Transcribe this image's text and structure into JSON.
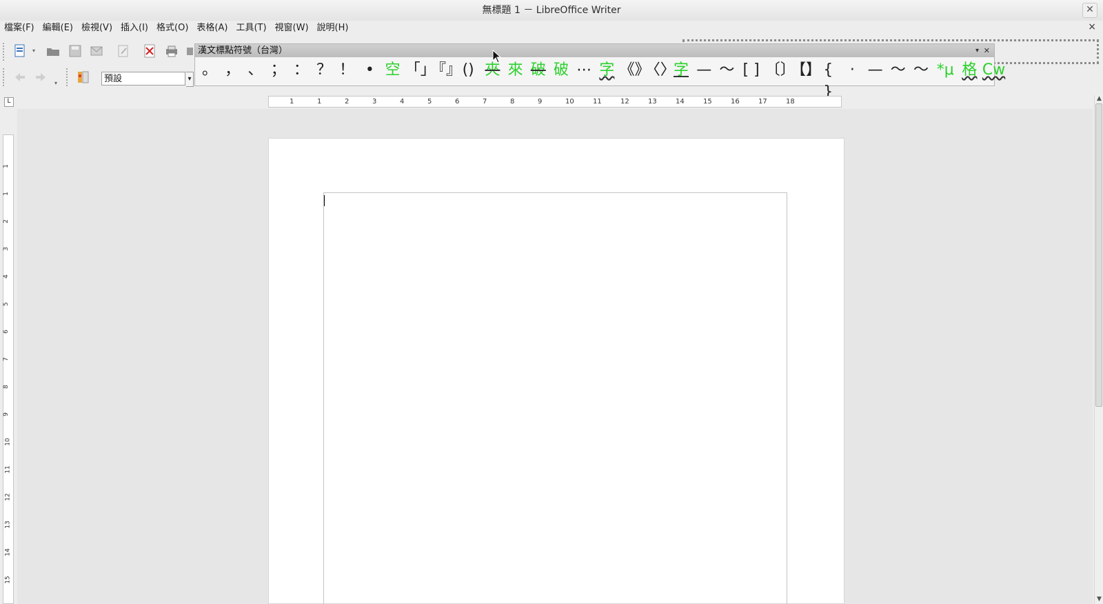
{
  "window": {
    "title": "無標題 1 － LibreOffice Writer",
    "close_glyph": "✕"
  },
  "menubar": {
    "items": [
      "檔案(F)",
      "編輯(E)",
      "檢視(V)",
      "插入(I)",
      "格式(O)",
      "表格(A)",
      "工具(T)",
      "視窗(W)",
      "說明(H)"
    ],
    "doc_close_glyph": "×"
  },
  "toolbar": {
    "paragraph_style": "預設"
  },
  "punctuation_panel": {
    "title": "漢文標點符號（台灣）",
    "menu_glyph": "▾",
    "close_glyph": "✕",
    "symbols": [
      {
        "char": "。"
      },
      {
        "char": "，"
      },
      {
        "char": "、"
      },
      {
        "char": "；"
      },
      {
        "char": "："
      },
      {
        "char": "？"
      },
      {
        "char": "！"
      },
      {
        "char": "•"
      },
      {
        "char": "空",
        "style": "green"
      },
      {
        "char": "「」"
      },
      {
        "char": "『』"
      },
      {
        "char": "()"
      },
      {
        "char": "夾",
        "style": "green strike"
      },
      {
        "char": "來",
        "style": "green"
      },
      {
        "char": "破",
        "style": "green strike"
      },
      {
        "char": "破",
        "style": "green"
      },
      {
        "char": "⋯"
      },
      {
        "char": "字",
        "style": "green wavy"
      },
      {
        "char": "《》"
      },
      {
        "char": "〈〉"
      },
      {
        "char": "字",
        "style": "green under"
      },
      {
        "char": "—"
      },
      {
        "char": "～"
      },
      {
        "char": "[ ]"
      },
      {
        "char": "〔〕"
      },
      {
        "char": "【】"
      },
      {
        "char": "{ }"
      },
      {
        "char": "·"
      },
      {
        "char": "—"
      },
      {
        "char": "～"
      },
      {
        "char": "～"
      },
      {
        "char": "*μ",
        "style": "green"
      },
      {
        "char": "格",
        "style": "green wavy"
      },
      {
        "char": "Cw",
        "style": "green wavy"
      }
    ]
  },
  "ruler": {
    "h_labels": [
      "1",
      "1",
      "2",
      "3",
      "4",
      "5",
      "6",
      "7",
      "8",
      "9",
      "10",
      "11",
      "12",
      "13",
      "14",
      "15",
      "16",
      "17",
      "18"
    ],
    "v_labels": [
      "1",
      "1",
      "2",
      "3",
      "4",
      "5",
      "6",
      "7",
      "8",
      "9",
      "10",
      "11",
      "12",
      "13",
      "14",
      "15"
    ]
  },
  "scroll": {
    "up_glyph": "▲",
    "down_glyph": "▼"
  }
}
